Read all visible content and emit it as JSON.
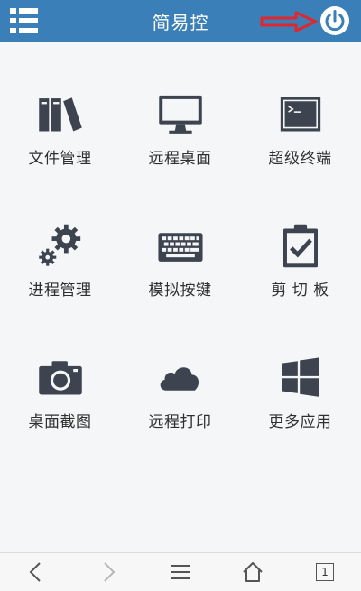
{
  "header": {
    "title": "简易控",
    "menu_icon": "list-menu-icon",
    "power_icon": "power-icon",
    "annotation_arrow_color": "#e3262b",
    "bar_color": "#3a7fb8"
  },
  "tiles": [
    {
      "label": "文件管理",
      "icon": "books-icon"
    },
    {
      "label": "远程桌面",
      "icon": "monitor-icon"
    },
    {
      "label": "超级终端",
      "icon": "terminal-icon"
    },
    {
      "label": "进程管理",
      "icon": "gears-icon"
    },
    {
      "label": "模拟按键",
      "icon": "keyboard-icon"
    },
    {
      "label": "剪 切 板",
      "icon": "clipboard-check-icon"
    },
    {
      "label": "桌面截图",
      "icon": "camera-icon"
    },
    {
      "label": "远程打印",
      "icon": "cloud-icon"
    },
    {
      "label": "更多应用",
      "icon": "windows-icon"
    }
  ],
  "bottom_nav": {
    "tab_count": "1",
    "icons": [
      "back-arrow-icon",
      "forward-arrow-icon",
      "menu-lines-icon",
      "home-icon",
      "tabs-icon"
    ]
  },
  "colors": {
    "icon": "#3d4450",
    "background": "#f5f6f8"
  }
}
